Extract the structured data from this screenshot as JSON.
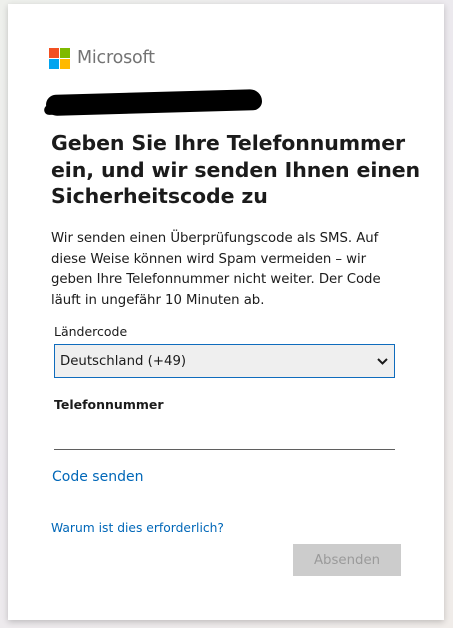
{
  "brand": {
    "name": "Microsoft",
    "logo_colors": [
      "#f25022",
      "#7fba00",
      "#00a4ef",
      "#ffb900"
    ]
  },
  "account": {
    "redacted_value": ""
  },
  "heading": {
    "title": "Geben Sie Ihre Telefonnummer ein, und wir senden Ihnen einen Sicherheitscode zu",
    "description": "Wir senden einen Überprüfungscode als SMS. Auf diese Weise können wird Spam vermeiden – wir geben Ihre Telefonnummer nicht weiter. Der Code läuft in ungefähr 10 Minuten ab."
  },
  "form": {
    "country_label": "Ländercode",
    "country_selected": "Deutschland (+49)",
    "phone_label": "Telefonnummer",
    "phone_value": "",
    "phone_placeholder": "",
    "send_code_link": "Code senden",
    "why_link": "Warum ist dies erforderlich?",
    "submit_label": "Absenden"
  },
  "colors": {
    "link": "#0067b8",
    "select_border": "#0f6cbd",
    "submit_disabled_bg": "#cccccc",
    "submit_disabled_text": "#9a9a9a"
  }
}
